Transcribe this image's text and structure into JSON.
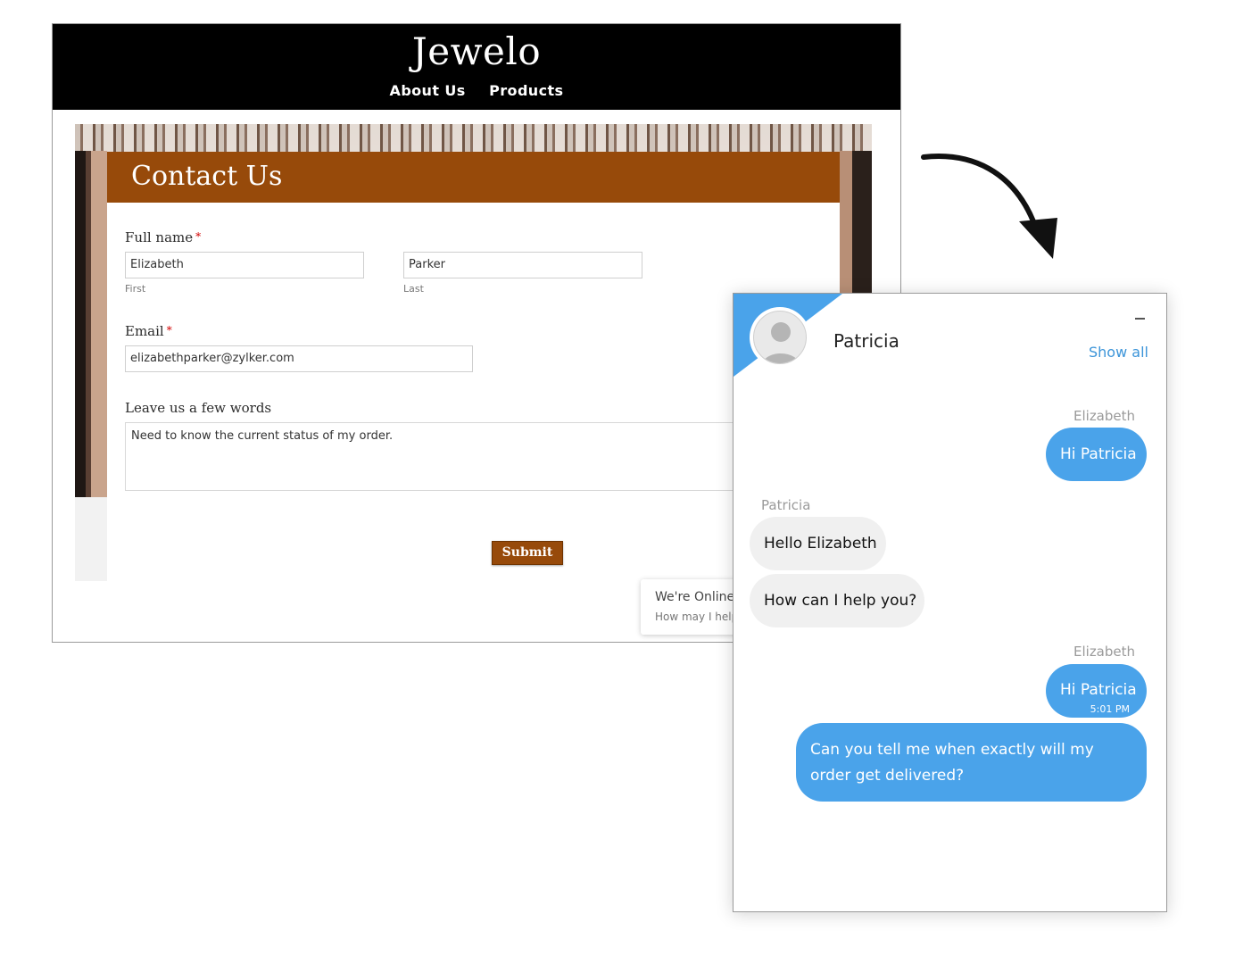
{
  "site": {
    "brand": "Jewelo",
    "nav": [
      "About Us",
      "Products"
    ],
    "form": {
      "title": "Contact Us",
      "fullname_label": "Full name",
      "required_mark": "*",
      "first_value": "Elizabeth",
      "first_sublabel": "First",
      "last_value": "Parker",
      "last_sublabel": "Last",
      "email_label": "Email",
      "email_value": "elizabethparker@zylker.com",
      "message_label": "Leave us a few words",
      "message_value": "Need to know the current status of my order.",
      "submit_label": "Submit"
    },
    "online_widget": {
      "line1": "We're Online!",
      "line2": "How may I help"
    },
    "colors": {
      "header": "#000000",
      "accent": "#974a0a"
    }
  },
  "chat": {
    "agent_name": "Patricia",
    "show_all": "Show all",
    "messages": [
      {
        "sender": "Elizabeth",
        "text": "Hi Patricia"
      },
      {
        "sender": "Patricia",
        "text": "Hello Elizabeth"
      },
      {
        "sender": "",
        "text": "How can I help you?"
      },
      {
        "sender": "Elizabeth",
        "text": "Hi Patricia",
        "time": "5:01 PM"
      },
      {
        "sender": "",
        "text": "Can you tell me when exactly will my order get delivered?"
      }
    ],
    "colors": {
      "outgoing": "#4aa3ea",
      "incoming": "#f0f0f0",
      "link": "#3d95d9"
    }
  },
  "icons": [
    "user-avatar-icon",
    "minimize-icon",
    "curved-arrow-icon"
  ]
}
